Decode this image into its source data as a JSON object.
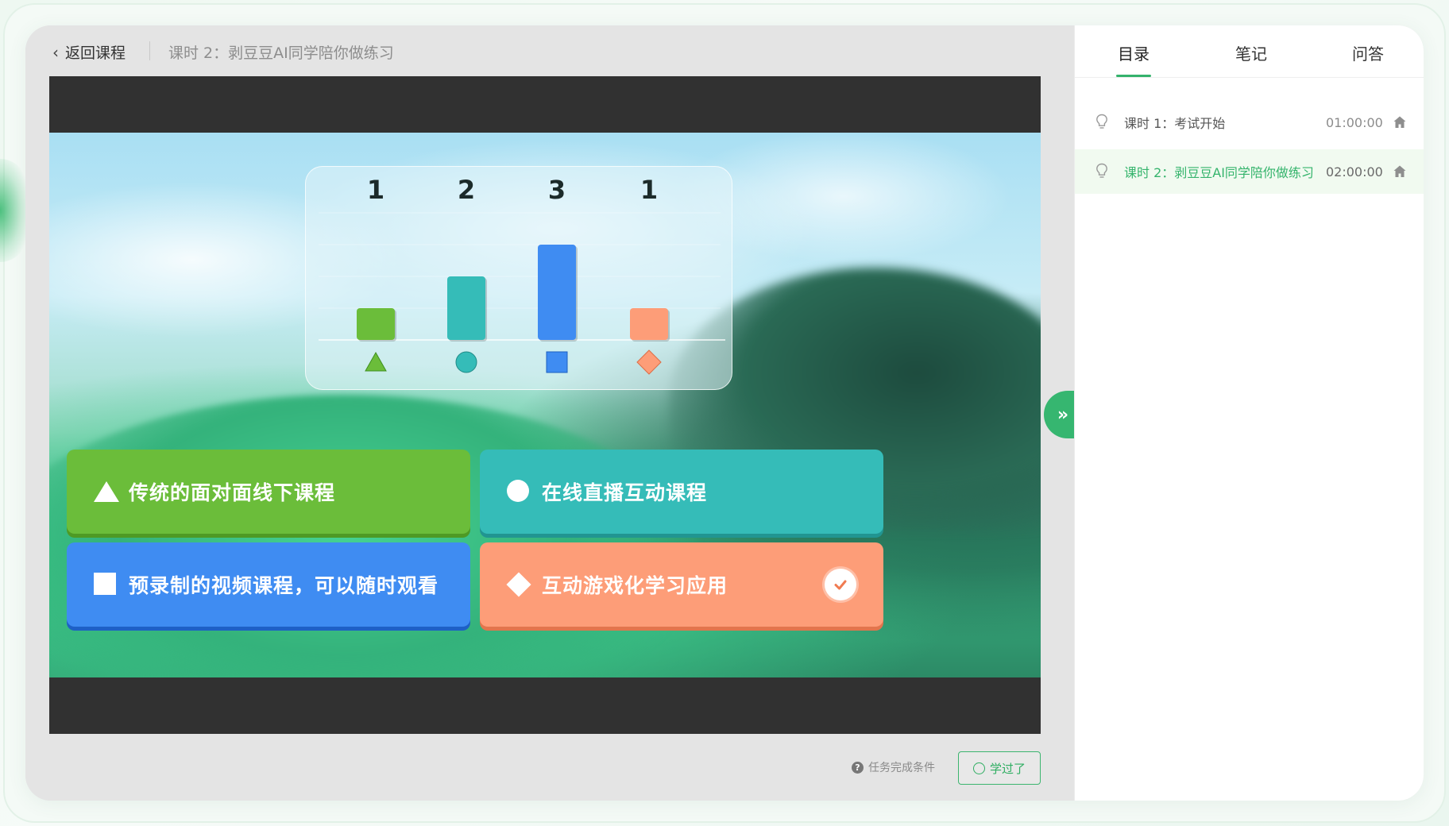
{
  "header": {
    "back_label": "返回课程",
    "breadcrumb": "课时 2：剥豆豆AI同学陪你做练习"
  },
  "quiz": {
    "chart_data": {
      "type": "bar",
      "categories": [
        "triangle",
        "circle",
        "square",
        "diamond"
      ],
      "values": [
        1,
        2,
        3,
        1
      ],
      "value_labels": [
        "1",
        "2",
        "3",
        "1"
      ],
      "colors": [
        "#6bbd3a",
        "#35bcb8",
        "#3f8cf2",
        "#fd9d78"
      ],
      "title": "",
      "xlabel": "",
      "ylabel": ""
    },
    "options": [
      {
        "symbol": "triangle",
        "label": "传统的面对面线下课程",
        "color": "#6bbd3a",
        "selected": false
      },
      {
        "symbol": "circle",
        "label": "在线直播互动课程",
        "color": "#35bcb8",
        "selected": false
      },
      {
        "symbol": "square",
        "label": "预录制的视频课程，可以随时观看",
        "color": "#3f8cf2",
        "selected": false
      },
      {
        "symbol": "diamond",
        "label": "互动游戏化学习应用",
        "color": "#fd9d78",
        "selected": true
      }
    ]
  },
  "footer": {
    "help_text": "任务完成条件",
    "learned_label": "学过了"
  },
  "sidebar": {
    "toggle_glyph": "»",
    "tabs": [
      {
        "label": "目录",
        "active": true
      },
      {
        "label": "笔记",
        "active": false
      },
      {
        "label": "问答",
        "active": false
      }
    ],
    "lessons": [
      {
        "title": "课时 1：考试开始",
        "duration": "01:00:00",
        "active": false
      },
      {
        "title": "课时 2：剥豆豆AI同学陪你做练习",
        "duration": "02:00:00",
        "active": true
      }
    ]
  },
  "icons": {
    "back": "chevron-left-icon",
    "help": "question-circle-icon",
    "lesson": "lightbulb-icon",
    "home": "home-icon",
    "check": "check-circle-icon",
    "expand": "double-chevron-right-icon"
  },
  "colors": {
    "accent": "#34b26c",
    "video_bg": "#313131"
  }
}
